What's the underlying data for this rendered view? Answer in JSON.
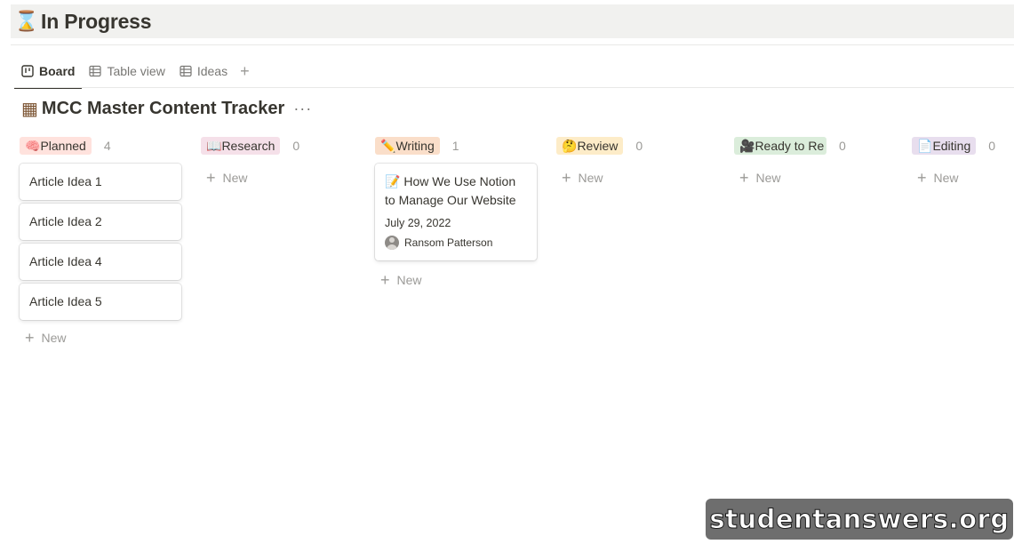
{
  "page": {
    "icon": "hourglass-icon",
    "icon_glyph": "⌛",
    "title": "In Progress"
  },
  "tabs": [
    {
      "label": "Board",
      "icon": "board-icon",
      "active": true
    },
    {
      "label": "Table view",
      "icon": "table-icon",
      "active": false
    },
    {
      "label": "Ideas",
      "icon": "table-icon",
      "active": false
    }
  ],
  "tab_add_glyph": "+",
  "database": {
    "icon": "tracker-icon",
    "icon_glyph": "▦",
    "title": "MCC Master Content Tracker",
    "more_glyph": "···"
  },
  "new_label": "New",
  "plus_glyph": "+",
  "columns": [
    {
      "label": "Planned",
      "emoji": "🧠",
      "count": "4",
      "color": "#ffe2dd",
      "cards": [
        {
          "title": "Article Idea 1"
        },
        {
          "title": "Article Idea 2"
        },
        {
          "title": "Article Idea 4"
        },
        {
          "title": "Article Idea 5"
        }
      ]
    },
    {
      "label": "Research",
      "emoji": "📖",
      "count": "0",
      "color": "#f5e0e9",
      "cards": []
    },
    {
      "label": "Writing",
      "emoji": "✏️",
      "count": "1",
      "color": "#fadec9",
      "cards": [
        {
          "emoji": "📝",
          "title": "How We Use Notion to Manage Our Website",
          "date": "July 29, 2022",
          "person": "Ransom Patterson"
        }
      ]
    },
    {
      "label": "Review",
      "emoji": "🤔",
      "count": "0",
      "color": "#fdecc8",
      "cards": []
    },
    {
      "label": "Ready to Re",
      "emoji": "🎥",
      "count": "0",
      "color": "#dbeddb",
      "cards": []
    },
    {
      "label": "Editing",
      "emoji": "📄",
      "count": "0",
      "color": "#e8deee",
      "cards": []
    }
  ],
  "watermark": "studentanswers.org"
}
